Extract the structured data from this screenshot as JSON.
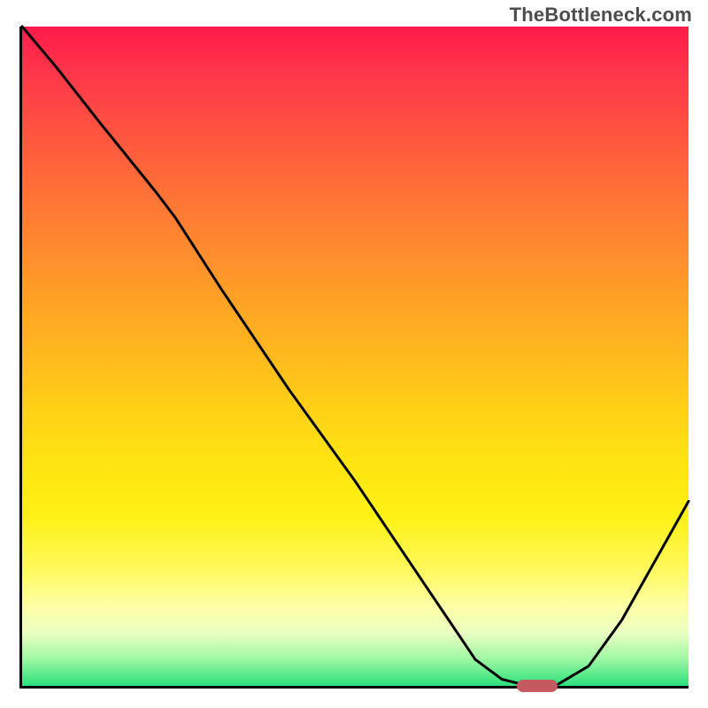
{
  "watermark": "TheBottleneck.com",
  "colors": {
    "gradient_top": "#ff1a4b",
    "gradient_bottom": "#2be07d",
    "curve": "#000000",
    "marker": "#c45a5f",
    "axis": "#000000"
  },
  "chart_data": {
    "type": "line",
    "title": "",
    "xlabel": "",
    "ylabel": "",
    "xlim": [
      0,
      100
    ],
    "ylim": [
      0,
      100
    ],
    "x": [
      0,
      5,
      12,
      20,
      23,
      30,
      40,
      50,
      60,
      68,
      72,
      76,
      80,
      85,
      90,
      95,
      100
    ],
    "values": [
      100,
      94,
      85,
      75,
      71,
      60,
      45,
      31,
      16,
      4,
      1,
      0,
      0,
      3,
      10,
      19,
      28
    ],
    "marker": {
      "x_start": 74,
      "x_end": 80,
      "y": 0
    },
    "annotations": []
  }
}
